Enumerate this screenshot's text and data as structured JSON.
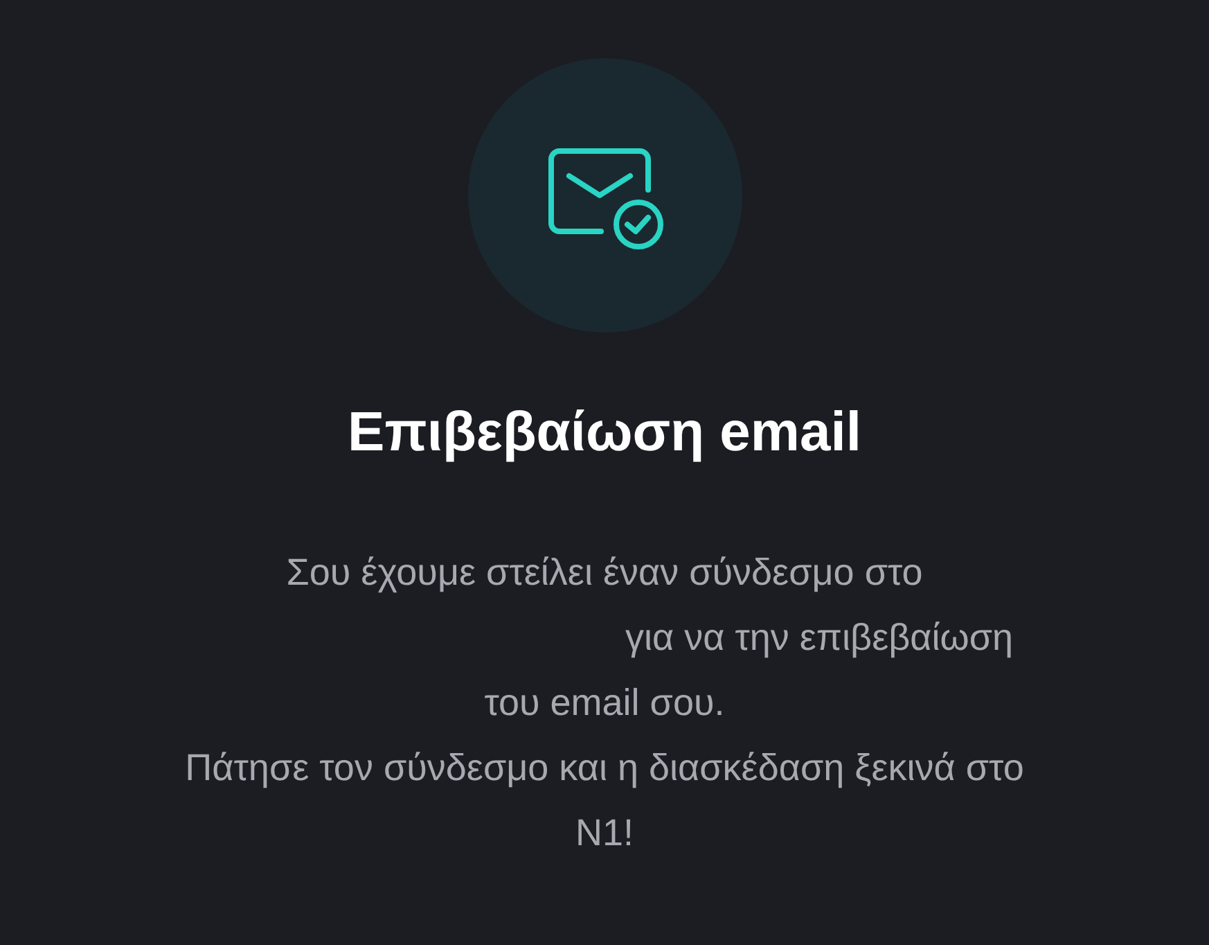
{
  "title": "Επιβεβαίωση email",
  "lines": [
    {
      "kind": "plain",
      "text": "Σου έχουμε στείλει έναν σύνδεσμο στο"
    },
    {
      "kind": "after-hidden-address",
      "text": "για να την επιβεβαίωση"
    },
    {
      "kind": "plain",
      "text": "του email σου."
    },
    {
      "kind": "plain",
      "text": "Πάτησε τον σύνδεσμο και η διασκέδαση ξεκινά στο"
    },
    {
      "kind": "plain",
      "text": "N1!"
    }
  ]
}
